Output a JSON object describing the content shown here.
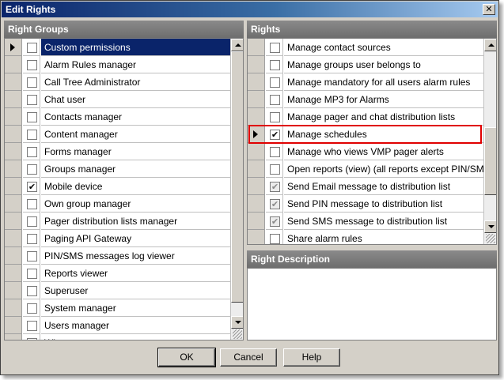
{
  "window": {
    "title": "Edit Rights",
    "close_glyph": "✕"
  },
  "left_panel": {
    "header": "Right Groups",
    "rows": [
      {
        "label": "Custom permissions",
        "checked": false,
        "selected": true,
        "current": true
      },
      {
        "label": "Alarm Rules manager",
        "checked": false
      },
      {
        "label": "Call Tree Administrator",
        "checked": false
      },
      {
        "label": "Chat user",
        "checked": false
      },
      {
        "label": "Contacts manager",
        "checked": false
      },
      {
        "label": "Content manager",
        "checked": false
      },
      {
        "label": "Forms manager",
        "checked": false
      },
      {
        "label": "Groups manager",
        "checked": false
      },
      {
        "label": "Mobile device",
        "checked": true
      },
      {
        "label": "Own group manager",
        "checked": false
      },
      {
        "label": "Pager distribution lists manager",
        "checked": false
      },
      {
        "label": "Paging API Gateway",
        "checked": false
      },
      {
        "label": "PIN/SMS messages log viewer",
        "checked": false
      },
      {
        "label": "Reports viewer",
        "checked": false
      },
      {
        "label": "Superuser",
        "checked": false
      },
      {
        "label": "System manager",
        "checked": false
      },
      {
        "label": "Users manager",
        "checked": false
      },
      {
        "label": "Wi...",
        "checked": false
      }
    ]
  },
  "right_panel": {
    "header": "Rights",
    "rows": [
      {
        "label": "Manage contact sources",
        "checked": false
      },
      {
        "label": "Manage groups user belongs to",
        "checked": false
      },
      {
        "label": "Manage mandatory for all users alarm rules",
        "checked": false
      },
      {
        "label": "Manage MP3 for Alarms",
        "checked": false
      },
      {
        "label": "Manage pager and chat distribution lists",
        "checked": false
      },
      {
        "label": "Manage schedules",
        "checked": true,
        "current": true,
        "highlighted": true
      },
      {
        "label": "Manage who views VMP pager alerts",
        "checked": false
      },
      {
        "label": "Open reports (view) (all reports except PIN/SMS r...",
        "checked": false
      },
      {
        "label": "Send Email message to distribution list",
        "checked": true,
        "disabled": true
      },
      {
        "label": "Send PIN message to distribution list",
        "checked": true,
        "disabled": true
      },
      {
        "label": "Send SMS message to distribution list",
        "checked": true,
        "disabled": true
      },
      {
        "label": "Share alarm rules",
        "checked": false
      }
    ]
  },
  "description_panel": {
    "header": "Right Description",
    "text": ""
  },
  "buttons": {
    "ok": "OK",
    "cancel": "Cancel",
    "help": "Help"
  },
  "check_glyph": "✔"
}
